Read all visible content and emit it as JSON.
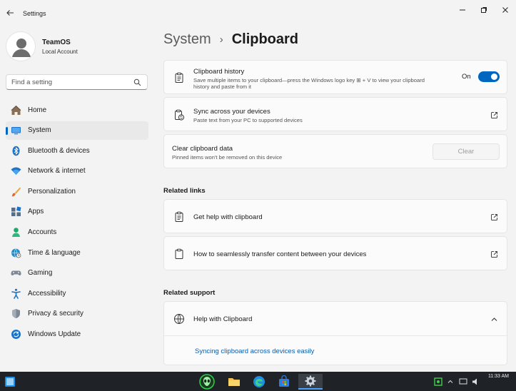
{
  "window": {
    "app_title": "Settings"
  },
  "profile": {
    "name": "TeamOS",
    "account_type": "Local Account"
  },
  "search": {
    "placeholder": "Find a setting"
  },
  "nav": {
    "items": [
      {
        "label": "Home",
        "icon": "home-icon"
      },
      {
        "label": "System",
        "icon": "system-icon",
        "active": true
      },
      {
        "label": "Bluetooth & devices",
        "icon": "bluetooth-icon"
      },
      {
        "label": "Network & internet",
        "icon": "wifi-icon"
      },
      {
        "label": "Personalization",
        "icon": "brush-icon"
      },
      {
        "label": "Apps",
        "icon": "apps-icon"
      },
      {
        "label": "Accounts",
        "icon": "accounts-icon"
      },
      {
        "label": "Time & language",
        "icon": "globe-clock-icon"
      },
      {
        "label": "Gaming",
        "icon": "gamepad-icon"
      },
      {
        "label": "Accessibility",
        "icon": "accessibility-icon"
      },
      {
        "label": "Privacy & security",
        "icon": "shield-icon"
      },
      {
        "label": "Windows Update",
        "icon": "update-icon"
      }
    ]
  },
  "breadcrumb": {
    "parent": "System",
    "separator": "›",
    "current": "Clipboard"
  },
  "clipboard_history": {
    "title": "Clipboard history",
    "description": "Save multiple items to your clipboard—press the Windows logo key ⊞ + V to view your clipboard history and paste from it",
    "toggle_label": "On",
    "toggle_on": true
  },
  "sync": {
    "title": "Sync across your devices",
    "description": "Paste text from your PC to supported devices"
  },
  "clear": {
    "title": "Clear clipboard data",
    "description": "Pinned items won't be removed on this device",
    "button_label": "Clear"
  },
  "related_links": {
    "heading": "Related links",
    "items": [
      {
        "label": "Get help with clipboard"
      },
      {
        "label": "How to seamlessly transfer content between your devices"
      }
    ]
  },
  "related_support": {
    "heading": "Related support",
    "help_title": "Help with Clipboard",
    "link": "Syncing clipboard across devices easily"
  },
  "taskbar": {
    "time": "11:33 AM"
  },
  "colors": {
    "accent": "#0067c0",
    "link": "#0b5cad"
  }
}
